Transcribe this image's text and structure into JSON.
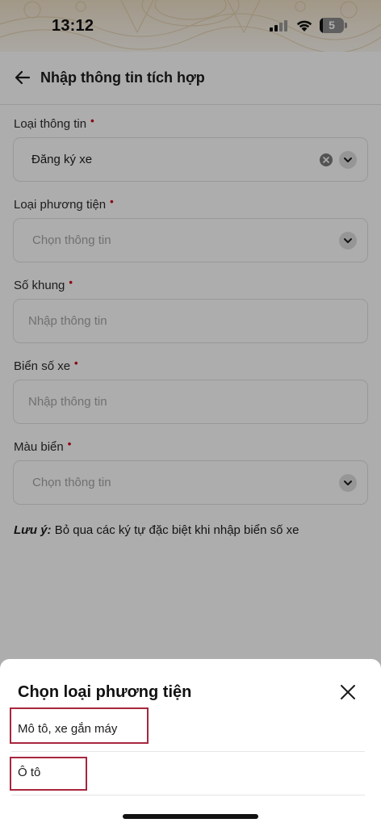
{
  "status_bar": {
    "time": "13:12",
    "battery": "5",
    "battery_level": 0.05
  },
  "header": {
    "title": "Nhập thông tin tích hợp"
  },
  "form": {
    "info_type": {
      "label": "Loại thông tin",
      "required": "•",
      "value": "Đăng ký xe"
    },
    "vehicle_type": {
      "label": "Loại phương tiện",
      "required": "•",
      "placeholder": "Chọn thông tin"
    },
    "frame_number": {
      "label": "Số khung",
      "required": "•",
      "placeholder": "Nhập thông tin"
    },
    "plate_number": {
      "label": "Biển số xe",
      "required": "•",
      "placeholder": "Nhập thông tin"
    },
    "plate_color": {
      "label": "Màu biển",
      "required": "•",
      "placeholder": "Chọn thông tin"
    }
  },
  "note": {
    "prefix": "Lưu ý:",
    "text": " Bỏ qua các ký tự đặc biệt khi nhập biển số xe"
  },
  "sheet": {
    "title": "Chọn loại phương tiện",
    "options": [
      {
        "label": "Mô tô, xe gắn máy"
      },
      {
        "label": "Ô tô"
      }
    ]
  },
  "colors": {
    "required": "#d0021b",
    "highlight": "#a8263e",
    "overlay": "rgba(0,0,0,0.32)"
  },
  "icons": [
    "back-arrow-icon",
    "chevron-down-icon",
    "clear-icon",
    "close-icon",
    "signal-icon",
    "wifi-icon",
    "battery-icon"
  ]
}
